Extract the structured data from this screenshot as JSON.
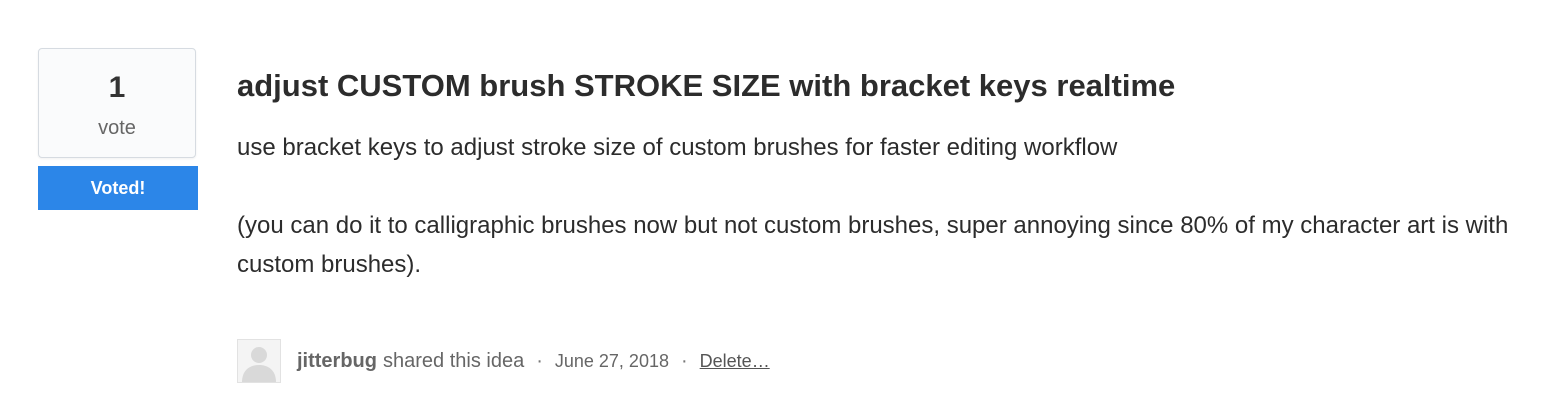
{
  "vote": {
    "count": "1",
    "label": "vote",
    "button_label": "Voted!",
    "button_color": "#2c86e8"
  },
  "idea": {
    "title": "adjust CUSTOM brush STROKE SIZE with bracket keys realtime",
    "paragraphs": [
      "use bracket keys to adjust stroke size of custom brushes for faster editing workflow",
      "(you can do it to calligraphic brushes now but not custom brushes, super annoying since 80% of my character art is with custom brushes)."
    ]
  },
  "meta": {
    "avatar_icon": "default-user-avatar-icon",
    "author": "jitterbug",
    "action_text": "shared this idea",
    "separator": "·",
    "date": "June 27, 2018",
    "delete_label": "Delete…"
  }
}
